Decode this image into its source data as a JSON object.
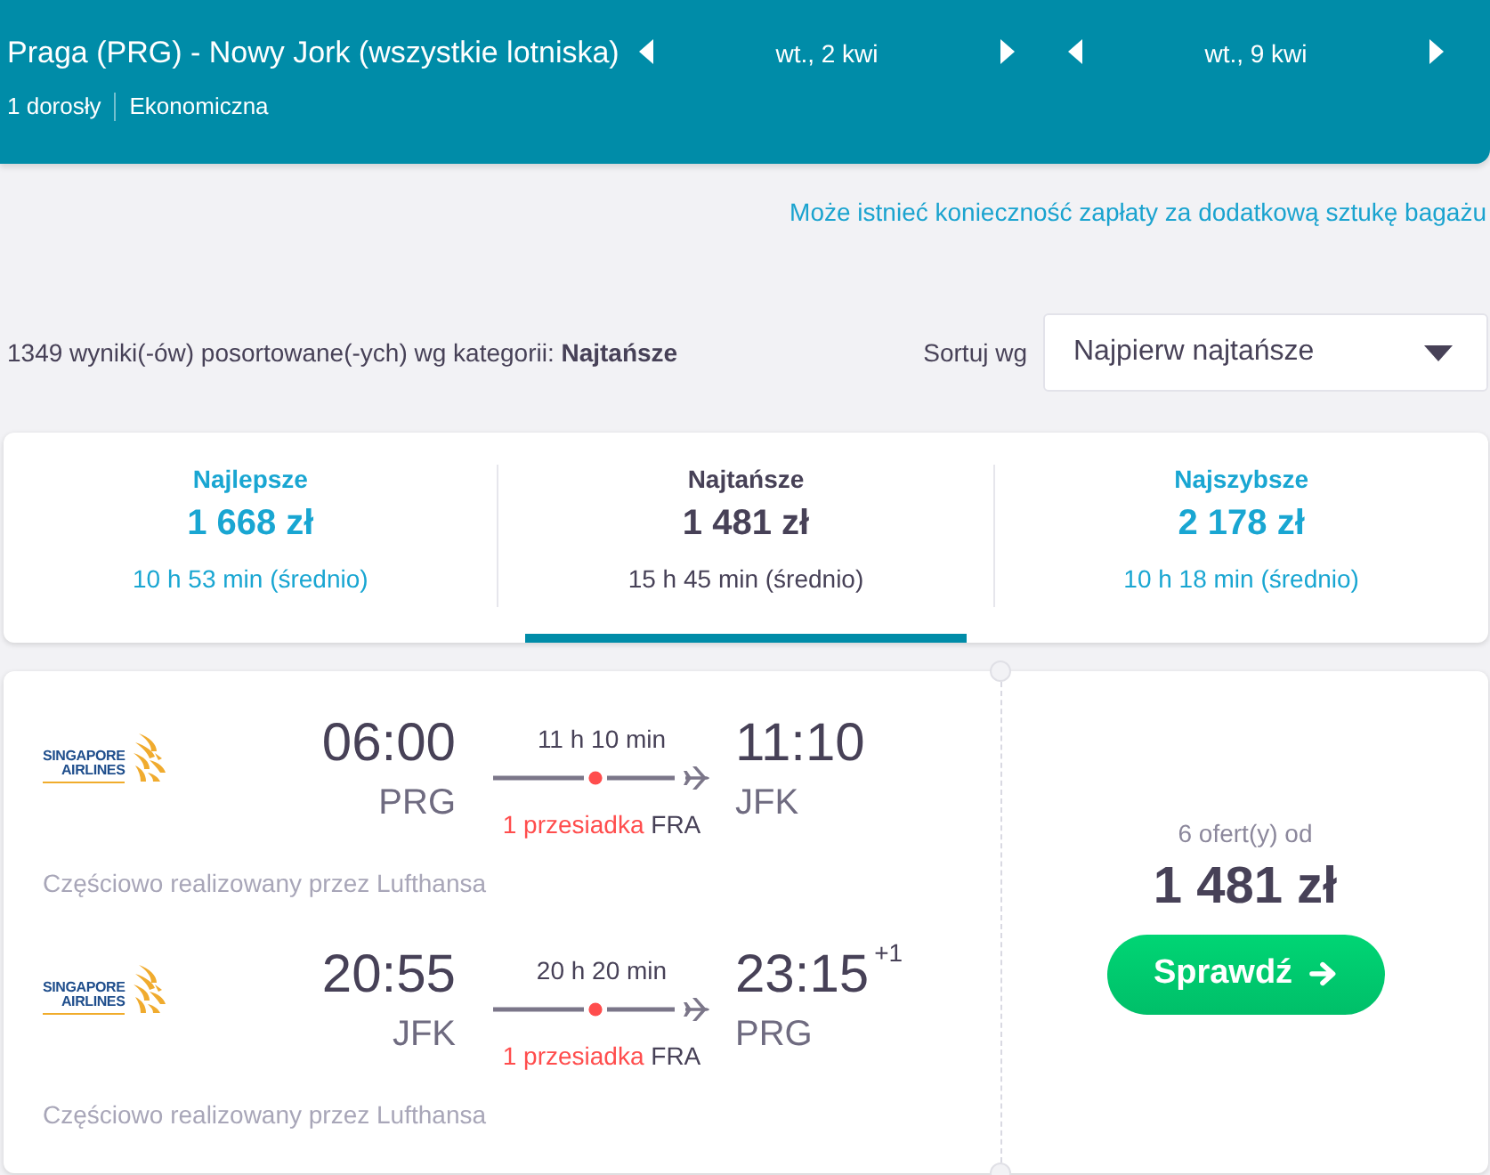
{
  "header": {
    "route": "Praga (PRG) - Nowy Jork (wszystkie lotniska)",
    "dates": [
      {
        "label": "wt., 2 kwi"
      },
      {
        "label": "wt., 9 kwi"
      }
    ],
    "passengers": "1 dorosły",
    "cabin": "Ekonomiczna"
  },
  "baggage_notice": "Może istnieć konieczność zapłaty za dodatkową sztukę bagażu",
  "results": {
    "summary": "1349 wyniki(-ów) posortowane(-ych) wg kategorii: **Najtańsze**",
    "sort_label": "Sortuj wg",
    "sort_value": "Najpierw najtańsze"
  },
  "sort_tabs": [
    {
      "label": "Najlepsze",
      "price": "1 668 zł",
      "duration": "10 h 53 min (średnio)",
      "selected": false
    },
    {
      "label": "Najtańsze",
      "price": "1 481 zł",
      "duration": "15 h 45 min (średnio)",
      "selected": true
    },
    {
      "label": "Najszybsze",
      "price": "2 178 zł",
      "duration": "10 h 18 min (średnio)",
      "selected": false
    }
  ],
  "flight": {
    "legs": [
      {
        "airline_logo": [
          "SINGAPORE",
          "AIRLINES"
        ],
        "departure_time": "06:00",
        "departure_airport": "PRG",
        "duration": "11 h 10 min",
        "stops": "1 przesiadka",
        "stop_airport": "FRA",
        "arrival_time": "11:10",
        "arrival_airport": "JFK",
        "operated_by": "Częściowo realizowany przez Lufthansa"
      },
      {
        "airline_logo": [
          "SINGAPORE",
          "AIRLINES"
        ],
        "departure_time": "20:55",
        "departure_airport": "JFK",
        "duration": "20 h 20 min",
        "stops": "1 przesiadka",
        "stop_airport": "FRA",
        "arrival_time": "23:15",
        "day_offset": "+1",
        "arrival_airport": "PRG",
        "operated_by": "Częściowo realizowany przez Lufthansa"
      }
    ],
    "offers": "6 ofert(y) od",
    "price": "1 481 zł",
    "button": "Sprawdź"
  }
}
